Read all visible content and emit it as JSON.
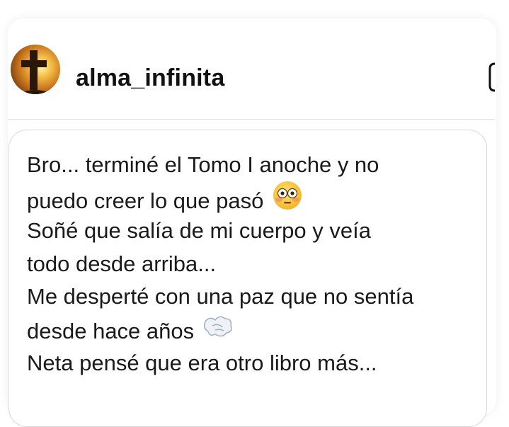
{
  "profile": {
    "username": "alma_infinita",
    "avatar_icon": "cross-sunset-avatar"
  },
  "message": {
    "lines": [
      "Bro... terminé el Tomo I anoche y no",
      "puedo creer lo que pasó",
      "Soñé que salía de mi cuerpo y veía",
      "todo desde arriba...",
      "Me desperté con una paz que no sentía",
      "desde hace años",
      "Neta pensé que era  otro libro más..."
    ],
    "emojis": [
      "flushed-face-emoji",
      "dash-emoji"
    ]
  },
  "colors": {
    "text": "#1a1a1a",
    "divider": "#e4e4e4",
    "bubble_border": "#d9d9d9",
    "emoji_yellow": "#f7c52a"
  }
}
